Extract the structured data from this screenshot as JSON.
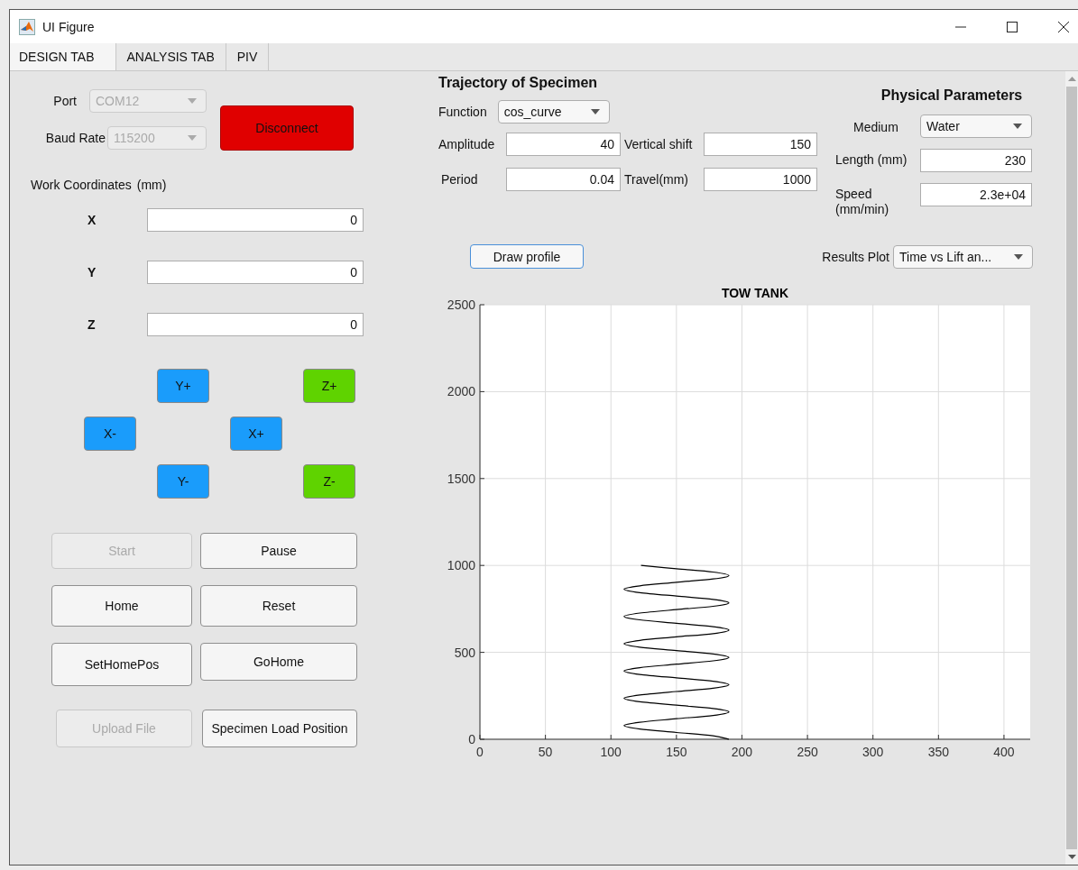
{
  "window": {
    "title": "UI Figure"
  },
  "tabs": [
    {
      "label": "DESIGN TAB",
      "selected": true
    },
    {
      "label": "ANALYSIS TAB",
      "selected": false
    },
    {
      "label": "PIV",
      "selected": false
    }
  ],
  "connection": {
    "port": {
      "label": "Port",
      "value": "COM12",
      "disabled": true
    },
    "baud_rate": {
      "label": "Baud Rate",
      "value": "115200",
      "disabled": true
    },
    "disconnect_button": "Disconnect"
  },
  "work_coordinates": {
    "label": "Work Coordinates",
    "unit": "(mm)",
    "axes": [
      {
        "label": "X",
        "value": "0"
      },
      {
        "label": "Y",
        "value": "0"
      },
      {
        "label": "Z",
        "value": "0"
      }
    ]
  },
  "jog_buttons": [
    {
      "label": "Y+",
      "color": "#1a9cfb"
    },
    {
      "label": "Z+",
      "color": "#5fd300"
    },
    {
      "label": "X-",
      "color": "#1a9cfb"
    },
    {
      "label": "X+",
      "color": "#1a9cfb"
    },
    {
      "label": "Y-",
      "color": "#1a9cfb"
    },
    {
      "label": "Z-",
      "color": "#5fd300"
    }
  ],
  "action_buttons": [
    {
      "label": "Start",
      "disabled": true
    },
    {
      "label": "Pause",
      "disabled": false
    },
    {
      "label": "Home",
      "disabled": false
    },
    {
      "label": "Reset",
      "disabled": false
    },
    {
      "label": "SetHomePos",
      "disabled": false
    },
    {
      "label": "GoHome",
      "disabled": false
    },
    {
      "label": "Upload File",
      "disabled": true
    },
    {
      "label": "Specimen Load Position",
      "disabled": false
    }
  ],
  "trajectory": {
    "title": "Trajectory of Specimen",
    "function": {
      "label": "Function",
      "value": "cos_curve"
    },
    "fields": [
      {
        "label": "Amplitude",
        "value": "40"
      },
      {
        "label": "Vertical shift",
        "value": "150"
      },
      {
        "label": "Period",
        "value": "0.04"
      },
      {
        "label": "Travel(mm)",
        "value": "1000"
      }
    ]
  },
  "physical_parameters": {
    "title": "Physical Parameters",
    "medium": {
      "label": "Medium",
      "value": "Water"
    },
    "fields": [
      {
        "label": "Length (mm)",
        "value": "230"
      },
      {
        "label": "Speed (mm/min)",
        "value": "2.3e+04"
      }
    ]
  },
  "draw_profile_button": "Draw profile",
  "results_plot": {
    "label": "Results Plot",
    "value": "Time vs Lift an..."
  },
  "chart_data": {
    "type": "line",
    "title": "TOW TANK",
    "grid": true,
    "xlim": [
      0,
      420
    ],
    "ylim": [
      0,
      2500
    ],
    "xticks": [
      0,
      50,
      100,
      150,
      200,
      250,
      300,
      350,
      400
    ],
    "yticks": [
      0,
      500,
      1000,
      1500,
      2000,
      2500
    ],
    "x": [
      190,
      178,
      150,
      122,
      110,
      122,
      150,
      178,
      190,
      178,
      150,
      122,
      110,
      122,
      150,
      178,
      190,
      178,
      150,
      122,
      110,
      122,
      150,
      178,
      190,
      178,
      150,
      122,
      110,
      122,
      150,
      178,
      190,
      178,
      150,
      122,
      110,
      122,
      150,
      178,
      190,
      178,
      150,
      122,
      110,
      122,
      150,
      178,
      190,
      178,
      150,
      123
    ],
    "series": [
      {
        "color": "#000000",
        "values": [
          0,
          20,
          39,
          59,
          79,
          98,
          118,
          137,
          157,
          177,
          196,
          216,
          236,
          255,
          275,
          294,
          314,
          334,
          353,
          373,
          393,
          412,
          432,
          451,
          471,
          491,
          510,
          530,
          550,
          569,
          589,
          608,
          628,
          648,
          667,
          687,
          707,
          726,
          746,
          765,
          785,
          805,
          824,
          844,
          864,
          883,
          903,
          922,
          942,
          962,
          981,
          1000
        ]
      }
    ]
  }
}
